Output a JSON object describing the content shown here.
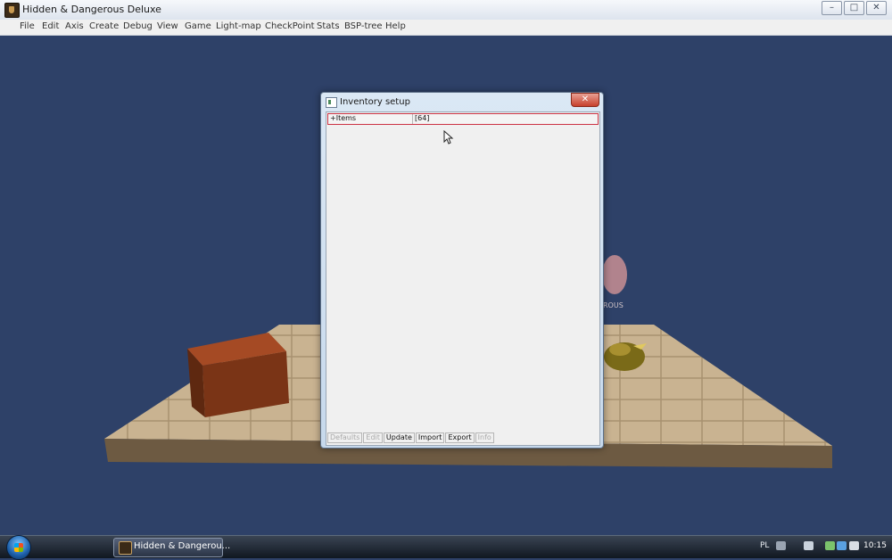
{
  "window": {
    "title": "Hidden & Dangerous Deluxe",
    "minimize": "–",
    "maximize": "□",
    "close": "✕"
  },
  "menu": [
    "File",
    "Edit",
    "Axis",
    "Create",
    "Debug",
    "View",
    "Game",
    "Light-map",
    "CheckPoint",
    "Stats",
    "BSP-tree",
    "Help"
  ],
  "scene": {
    "logo_text": "ROUS",
    "background_color": "#2e4168",
    "floor_color": "#c9b391",
    "crate_color": "#7a3416"
  },
  "dialog": {
    "title": "Inventory setup",
    "close": "✕",
    "row": {
      "name": "+Items",
      "value": "[64]"
    },
    "buttons": [
      {
        "label": "Defaults",
        "enabled": false
      },
      {
        "label": "Edit",
        "enabled": false
      },
      {
        "label": "Update",
        "enabled": true
      },
      {
        "label": "Import",
        "enabled": true
      },
      {
        "label": "Export",
        "enabled": true
      },
      {
        "label": "Info",
        "enabled": false
      }
    ]
  },
  "taskbar": {
    "task_label": "Hidden & Dangerou...",
    "language": "PL",
    "clock": "10:15"
  }
}
